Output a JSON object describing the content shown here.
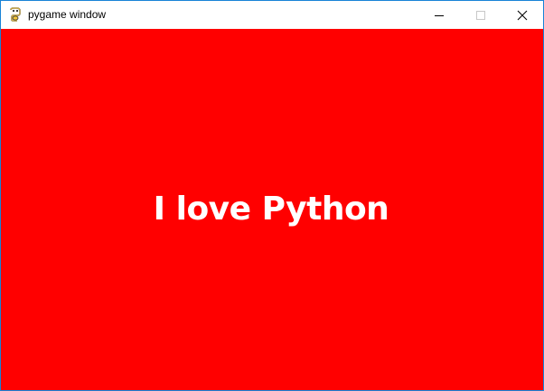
{
  "window": {
    "title": "pygame window",
    "icon": "python-snake-icon",
    "controls": [
      "minimize",
      "maximize",
      "close"
    ]
  },
  "canvas": {
    "background_color": "#ff0000",
    "text_color": "#ffffff",
    "message": "I love Python"
  },
  "colors": {
    "window_border": "#1883d7"
  }
}
